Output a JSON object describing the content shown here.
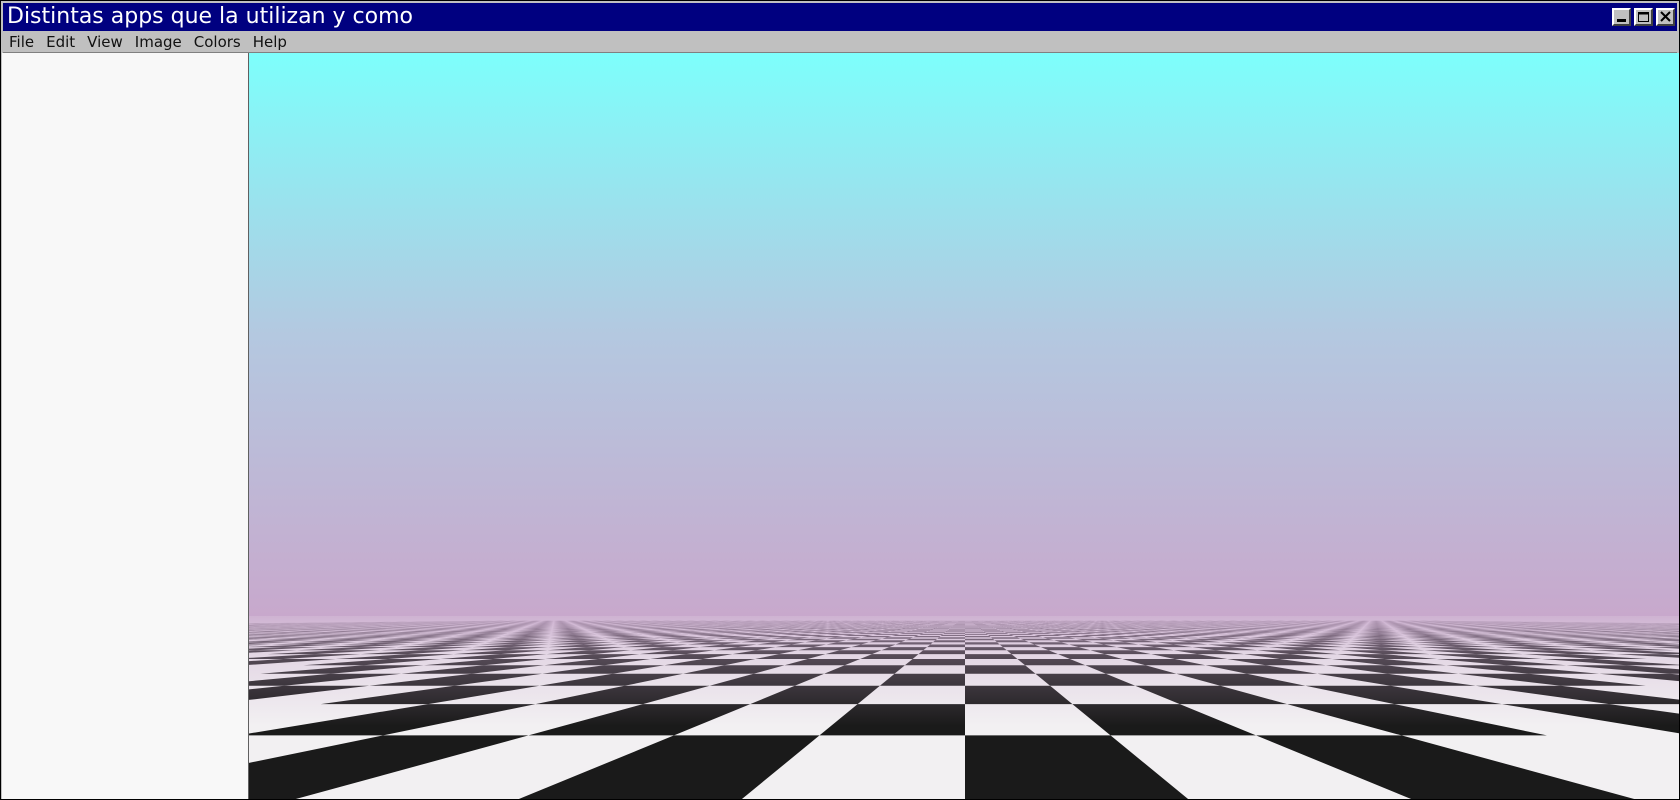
{
  "window": {
    "title": "Distintas apps que la utilizan y como",
    "buttons": [
      {
        "name": "minimize-icon"
      },
      {
        "name": "maximize-icon"
      },
      {
        "name": "close-icon"
      }
    ]
  },
  "menu": {
    "items": [
      "File",
      "Edit",
      "View",
      "Image",
      "Colors",
      "Help"
    ]
  },
  "canvas": {
    "image": "vaporwave gradient sky with perspective checkerboard floor",
    "sky_top_color": "#7dfffc",
    "sky_mid_color": "#b4c8e0",
    "sky_bottom_color": "#c8a8cc",
    "floor_light_color": "#f2f0f2",
    "floor_dark_color": "#1a1a1a"
  }
}
